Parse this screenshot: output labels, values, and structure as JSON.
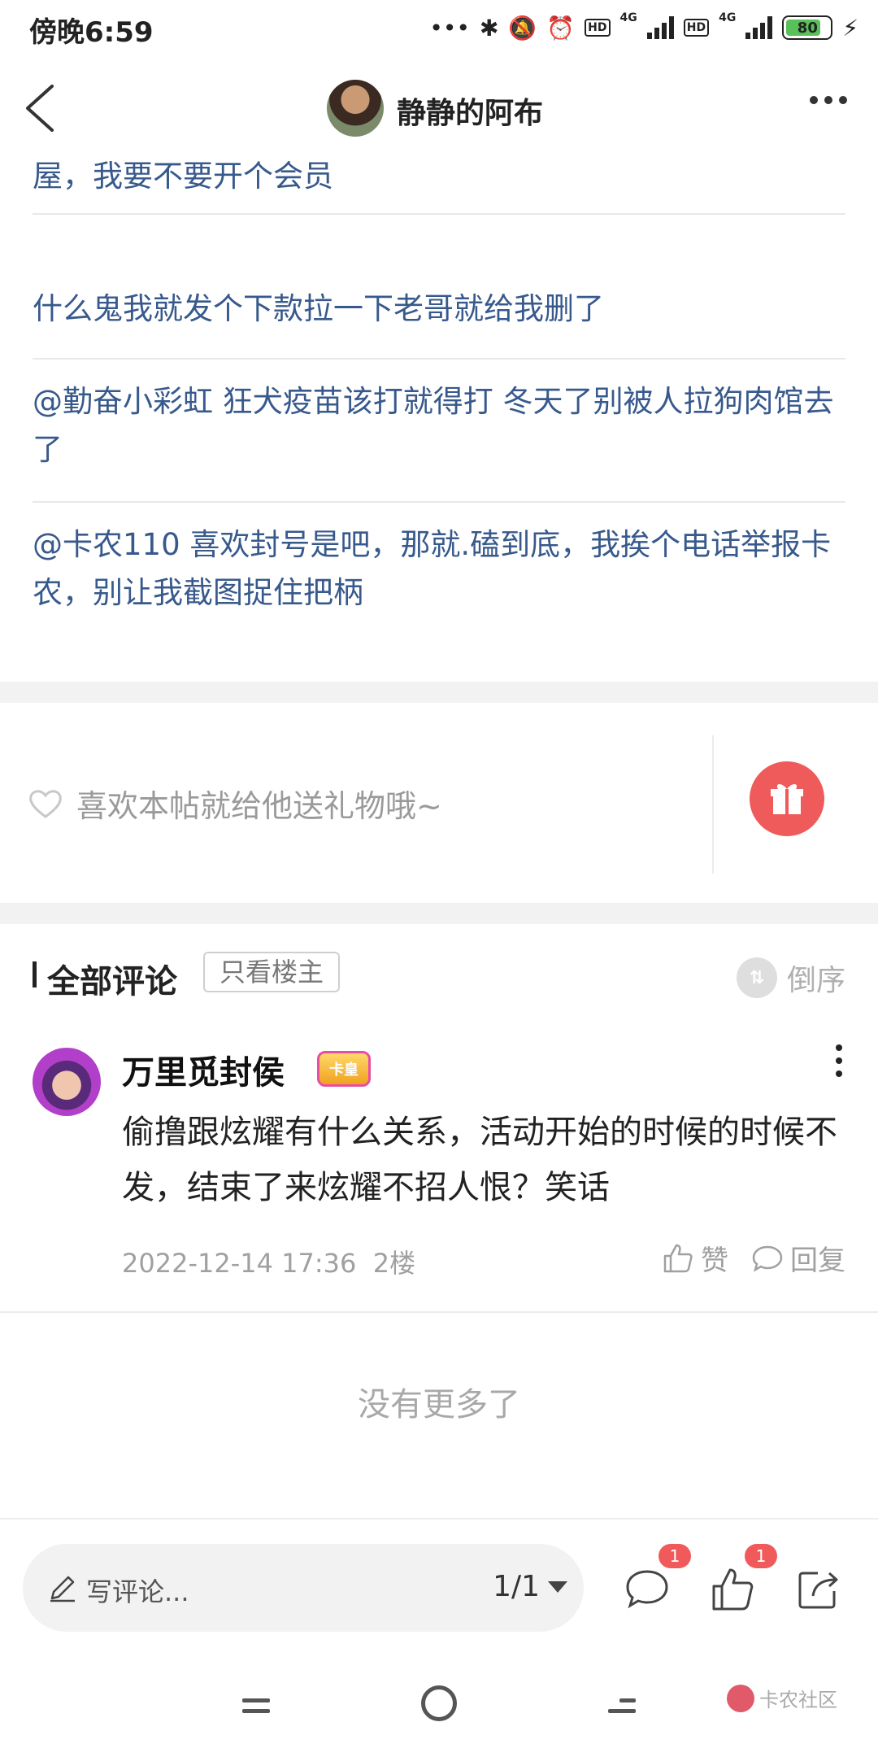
{
  "status": {
    "time": "傍晚6:59",
    "battery": "80",
    "network_a": "4G",
    "network_b": "4G",
    "hd_a": "HD",
    "hd_b": "HD"
  },
  "header": {
    "title": "静静的阿布"
  },
  "posts": [
    {
      "text": "无论发什么都会被小黑屋，复制别人的，别人没事我也是小黑屋，我要不要开个会员"
    },
    {
      "text": "什么鬼我就发个下款拉一下老哥就给我删了"
    },
    {
      "text": "@勤奋小彩虹 狂犬疫苗该打就得打 冬天了别被人拉狗肉馆去了"
    },
    {
      "text": "@卡农110 喜欢封号是吧，那就.磕到底，我挨个电话举报卡农，别让我截图捉住把柄"
    }
  ],
  "gift": {
    "prompt": "喜欢本帖就给他送礼物哦~"
  },
  "comments_section": {
    "title": "全部评论",
    "filter_label": "只看楼主",
    "sort_label": "倒序"
  },
  "comment": {
    "username": "万里觅封侯",
    "badge": "卡皇",
    "body": "偷撸跟炫耀有什么关系，活动开始的时候的时候不发，结束了来炫耀不招人恨？笑话",
    "timestamp": "2022-12-14 17:36",
    "floor": "2楼",
    "like_label": "赞",
    "reply_label": "回复"
  },
  "no_more": "没有更多了",
  "input_bar": {
    "placeholder": "写评论...",
    "pager": "1/1",
    "comment_count": "1",
    "like_count": "1"
  },
  "watermark": {
    "text": "卡农社区"
  }
}
